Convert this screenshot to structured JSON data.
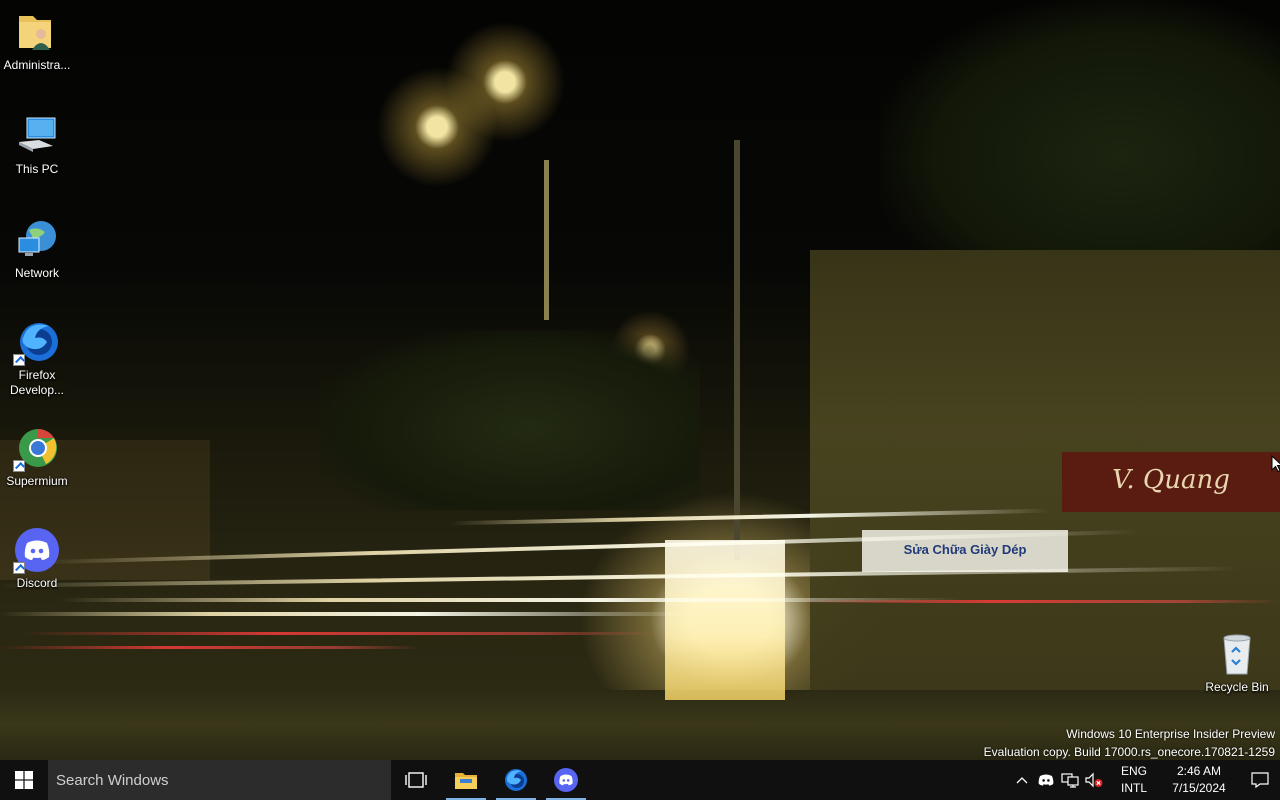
{
  "desktop": {
    "icons": [
      {
        "label": "Administra...",
        "icon": "user-folder-icon"
      },
      {
        "label": "This PC",
        "icon": "computer-icon"
      },
      {
        "label": "Network",
        "icon": "network-icon"
      },
      {
        "label": "Firefox Develop...",
        "icon": "firefox-developer-icon"
      },
      {
        "label": "Supermium",
        "icon": "supermium-icon"
      },
      {
        "label": "Discord",
        "icon": "discord-icon"
      },
      {
        "label": "Recycle Bin",
        "icon": "recycle-bin-icon"
      }
    ],
    "wallpaper": {
      "signs": [
        "V. Quang",
        "Sửa Chữa Giày Dép"
      ]
    }
  },
  "watermark": {
    "line1": "Windows 10 Enterprise Insider Preview",
    "line2": "Evaluation copy. Build 17000.rs_onecore.170821-1259"
  },
  "taskbar": {
    "search_placeholder": "Search Windows",
    "apps": [
      {
        "name": "Task View",
        "icon": "task-view-icon"
      },
      {
        "name": "File Explorer",
        "icon": "file-explorer-icon",
        "open": true
      },
      {
        "name": "Firefox Developer Edition",
        "icon": "firefox-developer-icon",
        "open": true
      },
      {
        "name": "Discord",
        "icon": "discord-icon",
        "open": true
      }
    ],
    "tray": {
      "lang_top": "ENG",
      "lang_bottom": "INTL",
      "time": "2:46 AM",
      "date": "7/15/2024"
    }
  },
  "colors": {
    "taskbar_bg": "#101010",
    "search_bg": "#2c2c2c",
    "accent": "#7fb2e5",
    "discord": "#5865f2"
  }
}
